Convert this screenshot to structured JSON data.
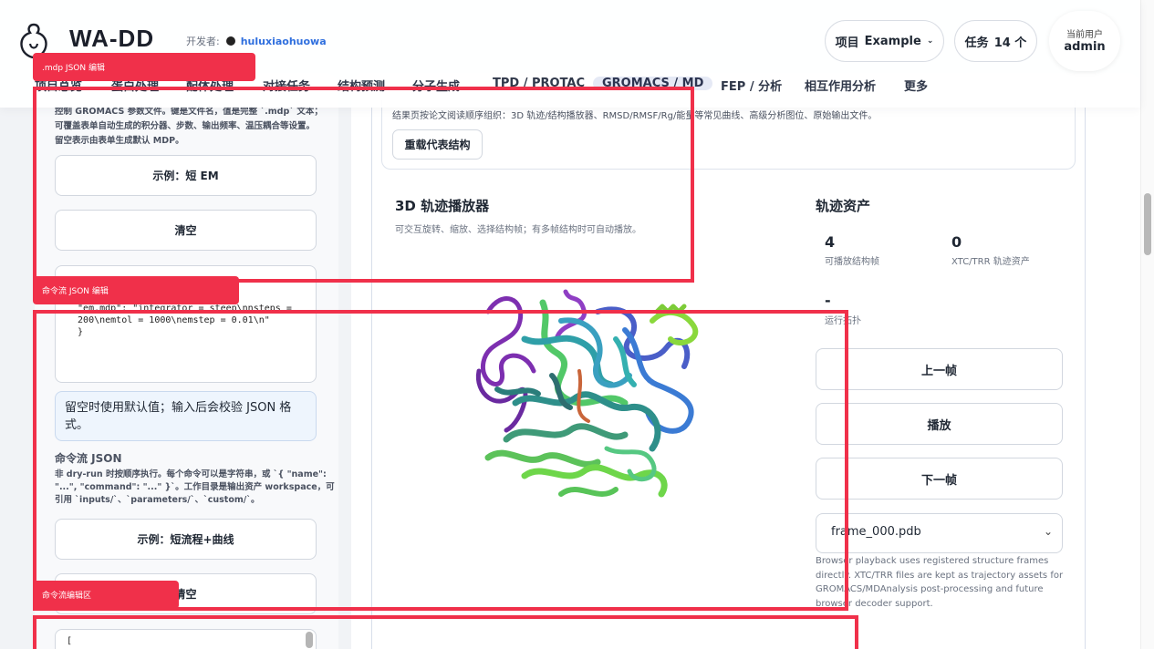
{
  "header": {
    "brand": "WA-DD",
    "developer_label": "开发者:",
    "developer_name": "huluxiaohuowa",
    "project_label": "项目",
    "project_value": "Example",
    "tasks_label": "任务",
    "tasks_value": "14 个",
    "user_label": "当前用户",
    "user_name": "admin"
  },
  "nav": {
    "items": [
      "项目总览",
      "蛋白处理",
      "配体处理",
      "对接任务",
      "结构预测",
      "分子生成",
      "TPD / PROTAC",
      "GROMACS / MD",
      "FEP / 分析",
      "相互作用分析",
      "更多"
    ]
  },
  "left": {
    "mdp_desc": [
      "控制 GROMACS 参数文件。键是文件名，值是完整 `.mdp` 文本；",
      "可覆盖表单自动生成的积分器、步数、输出频率、温压耦合等设置。",
      "留空表示由表单生成默认 MDP。"
    ],
    "example_em_button": "示例：短 EM",
    "clear_button_1": "清空",
    "mdp_textarea_value": "  \"em.mdp\": \"integrator = steep\\nnsteps =\n  200\\nemtol = 1000\\nemstep = 0.01\\n\"\n  }",
    "hint": "留空时使用默认值；输入后会校验 JSON 格式。",
    "commands_label": "命令流 JSON",
    "commands_desc": [
      "非 dry-run 时按顺序执行。每个命令可以是字符串，或 `{ \"name\":",
      "\"...\", \"command\": \"...\" }`。工作目录是输出资产 workspace，可",
      "引用 `inputs/`、`parameters/`、`custom/`。"
    ],
    "example_flow_button": "示例：短流程+曲线",
    "clear_button_2": "清空",
    "commands_textarea_value": "["
  },
  "right": {
    "summary_text": "结果页按论文阅读顺序组织：3D 轨迹/结构播放器、RMSD/RMSF/Rg/能量等常见曲线、高级分析图位、原始输出文件。",
    "reload_button": "重载代表结构",
    "player_title": "3D 轨迹播放器",
    "player_desc": "可交互旋转、缩放、选择结构帧；有多帧结构时可自动播放。",
    "assets_title": "轨迹资产",
    "stats": [
      {
        "value": "4",
        "label": "可播放结构帧"
      },
      {
        "value": "0",
        "label": "XTC/TRR 轨迹资产"
      },
      {
        "value": "-",
        "label": "运行拓扑"
      }
    ],
    "prev_button": "上一帧",
    "play_button": "播放",
    "next_button": "下一帧",
    "frame_select": "frame_000.pdb",
    "note": "Browser playback uses registered structure frames directly. XTC/TRR files are kept as trajectory assets for GROMACS/MDAnalysis post-processing and future browser decoder support."
  },
  "overlays": {
    "tag1": ".mdp JSON 编辑",
    "tag2": "命令流 JSON 编辑",
    "tag3": "命令流编辑区"
  },
  "colors": {
    "annotation": "#f0304a",
    "accent": "#2f6fde"
  }
}
